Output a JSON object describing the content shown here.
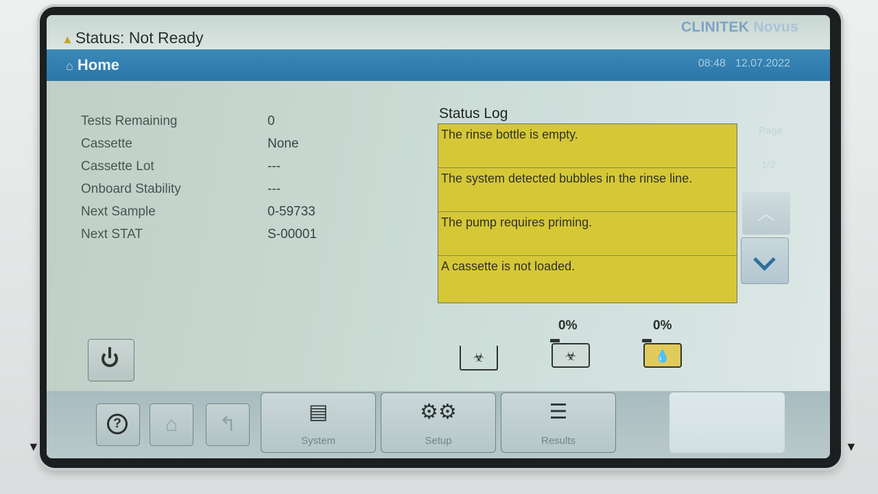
{
  "header": {
    "status_text": "Status: Not Ready",
    "brand_name": "CLINITEK",
    "brand_model": "Novus",
    "time": "08:48",
    "date": "12.07.2022"
  },
  "page": {
    "title": "Home"
  },
  "info": [
    {
      "label": "Tests Remaining",
      "value": "0"
    },
    {
      "label": "Cassette",
      "value": "None"
    },
    {
      "label": "Cassette Lot",
      "value": "---"
    },
    {
      "label": "Onboard Stability",
      "value": "---"
    },
    {
      "label": "Next Sample",
      "value": "0-59733"
    },
    {
      "label": "Next STAT",
      "value": "S-00001"
    }
  ],
  "status_log": {
    "title": "Status Log",
    "items": [
      "The rinse bottle is empty.",
      "The system detected bubbles in the rinse line.",
      "The pump requires priming.",
      "A cassette is not loaded."
    ],
    "page_label": "Page",
    "page_indicator": "1/2"
  },
  "consumables": {
    "waste_level": "0%",
    "rinse_level": "0%",
    "colors": {
      "log_bg": "#d6c737",
      "rinse_fill": "#e1ca5c",
      "header_blue": "#2b76a8"
    }
  },
  "nav": {
    "system_label": "System",
    "setup_label": "Setup",
    "results_label": "Results"
  },
  "icons": [
    "warning-icon",
    "home-icon",
    "chevron-up-icon",
    "chevron-down-icon",
    "biohazard-icon",
    "droplet-icon",
    "power-icon",
    "help-icon",
    "back-icon",
    "system-icon",
    "gears-icon",
    "clipboard-icon"
  ]
}
